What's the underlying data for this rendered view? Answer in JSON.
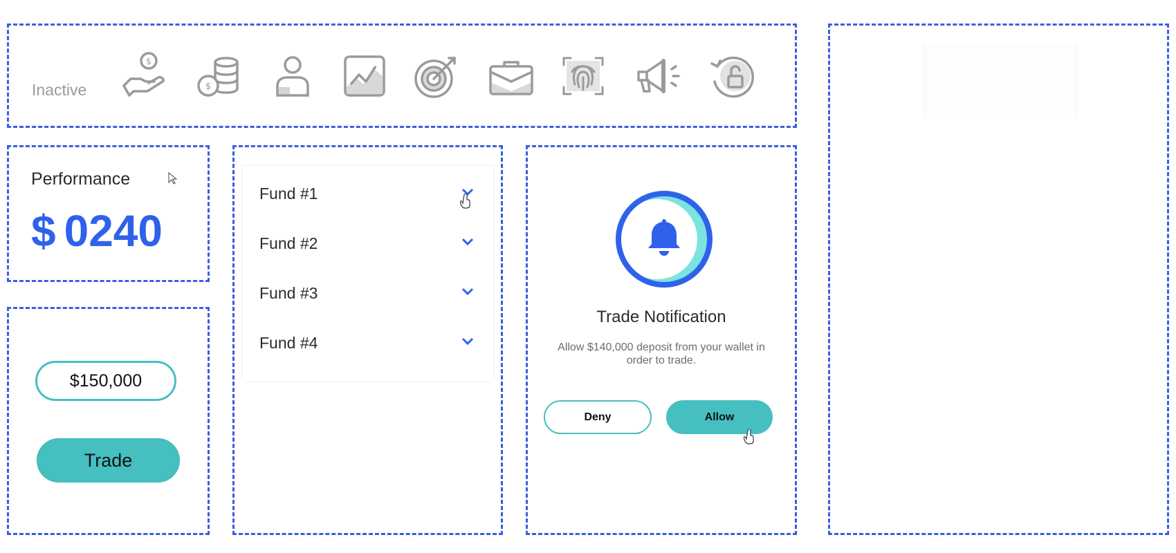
{
  "icons_panel": {
    "status_label": "Inactive",
    "icons": [
      "money-hand-icon",
      "coin-stack-icon",
      "user-icon",
      "line-chart-icon",
      "target-icon",
      "briefcase-icon",
      "fingerprint-icon",
      "megaphone-icon",
      "unlock-icon"
    ]
  },
  "performance": {
    "title": "Performance",
    "currency": "$",
    "value": "0240"
  },
  "trade": {
    "amount": "$150,000",
    "button_label": "Trade"
  },
  "funds": {
    "items": [
      {
        "label": "Fund #1"
      },
      {
        "label": "Fund #2"
      },
      {
        "label": "Fund #3"
      },
      {
        "label": "Fund #4"
      }
    ]
  },
  "notification": {
    "title": "Trade Notification",
    "message": "Allow $140,000 deposit from your wallet in order to trade.",
    "deny_label": "Deny",
    "allow_label": "Allow"
  },
  "colors": {
    "accent_blue": "#2f62ea",
    "teal": "#46bfc1",
    "light_teal": "#7be3e0",
    "icon_gray": "#9a9a9a",
    "dashed_border": "#3b5ee0"
  }
}
